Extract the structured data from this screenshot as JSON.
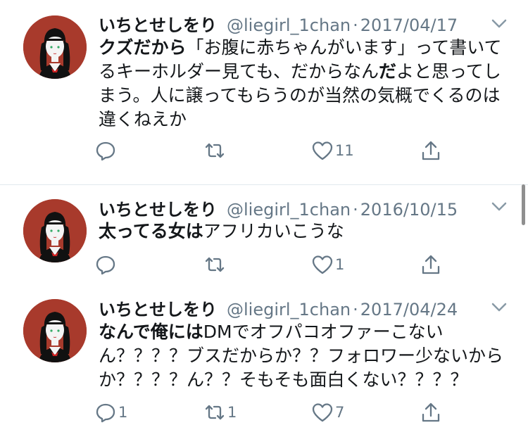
{
  "tweets": [
    {
      "name": "いちとせしをり",
      "handle": "@liegirl_1chan",
      "sep": "·",
      "date": "2017/04/17",
      "text_parts": [
        {
          "t": "クズだから",
          "bold": true
        },
        {
          "t": "「お腹に赤ちゃんがいます」って書いてるキーホルダー見ても、だからなん",
          "bold": false
        },
        {
          "t": "だ",
          "bold": true
        },
        {
          "t": "よと思ってしまう。人に譲ってもらうのが当然の気概でくるのは違くねえか",
          "bold": false
        }
      ],
      "reply_count": "",
      "retweet_count": "",
      "like_count": "11"
    },
    {
      "name": "いちとせしをり",
      "handle": "@liegirl_1chan",
      "sep": "·",
      "date": "2016/10/15",
      "text_parts": [
        {
          "t": "太ってる女は",
          "bold": true
        },
        {
          "t": "アフリカいこうな",
          "bold": false
        }
      ],
      "reply_count": "",
      "retweet_count": "",
      "like_count": "1"
    },
    {
      "name": "いちとせしをり",
      "handle": "@liegirl_1chan",
      "sep": "·",
      "date": "2017/04/24",
      "text_parts": [
        {
          "t": "なんで俺には",
          "bold": true
        },
        {
          "t": "DMでオフパコオファーこないん？？？？ブスだからか？？フォロワー少ないからか？？？？ん？？そもそも面白くない？？？？",
          "bold": false
        }
      ],
      "reply_count": "1",
      "retweet_count": "1",
      "like_count": "7"
    }
  ],
  "icons": {
    "reply": "reply-icon",
    "retweet": "retweet-icon",
    "like": "heart-icon",
    "share": "share-icon",
    "menu": "chevron-down-icon"
  },
  "colors": {
    "text": "#14171a",
    "secondary": "#657786",
    "avatar_bg": "#a83a2c",
    "divider": "#e1e8ed"
  }
}
